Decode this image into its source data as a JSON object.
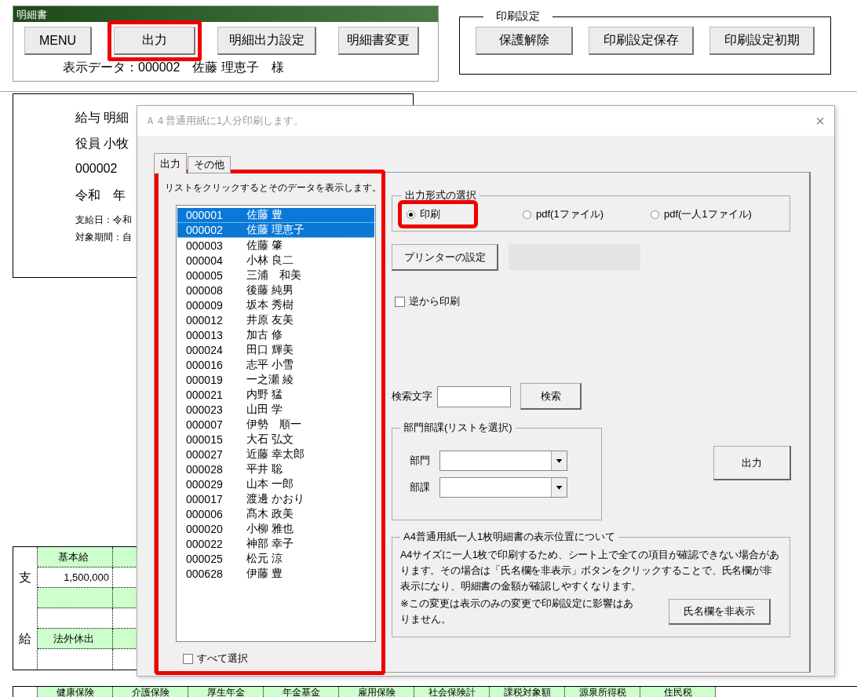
{
  "sheet_header": {
    "title": "明細書",
    "display_data": "表示データ：000002　佐藤 理恵子　様",
    "buttons": [
      {
        "label": "MENU",
        "highlighted": false
      },
      {
        "label": "出力",
        "highlighted": true
      },
      {
        "label": "明細出力設定",
        "highlighted": false
      },
      {
        "label": "明細書変更",
        "highlighted": false
      }
    ]
  },
  "print_settings": {
    "legend": "印刷設定",
    "buttons": [
      "保護解除",
      "印刷設定保存",
      "印刷設定初期"
    ]
  },
  "payslip_card": {
    "lines": [
      "給与 明細",
      "役員  小牧",
      "000002",
      "令和　年"
    ],
    "small_lines": [
      "支給日：令和",
      "対象期間：自"
    ]
  },
  "pay_table": {
    "side_labels": [
      "支",
      "給"
    ],
    "rows": [
      {
        "kind": "header",
        "text": "基本給"
      },
      {
        "kind": "value",
        "text": "1,500,000"
      },
      {
        "kind": "header"
      },
      {
        "kind": "value"
      },
      {
        "kind": "header",
        "text": "法外休出"
      },
      {
        "kind": "value"
      }
    ]
  },
  "deduction_headers": [
    "健康保険",
    "介護保険",
    "厚生年金",
    "年金基金",
    "雇用保険",
    "社会保険計",
    "課税対象額",
    "源泉所得税",
    "住民税"
  ],
  "dialog": {
    "title": "Ａ４普通用紙に1人分印刷します。",
    "close": "×",
    "tabs": [
      {
        "label": "出力",
        "selected": true
      },
      {
        "label": "その他",
        "selected": false
      }
    ],
    "list_panel": {
      "highlighted": true,
      "hint": "リストをクリックするとそのデータを表示します。",
      "select_all": {
        "label": "すべて選択",
        "checked": false
      },
      "items": [
        {
          "id": "000001",
          "name": "佐藤 豊",
          "selected": true
        },
        {
          "id": "000002",
          "name": "佐藤 理恵子",
          "selected": true
        },
        {
          "id": "000003",
          "name": "佐藤 肇",
          "selected": false
        },
        {
          "id": "000004",
          "name": "小林 良二",
          "selected": false
        },
        {
          "id": "000005",
          "name": "三浦　和美",
          "selected": false
        },
        {
          "id": "000008",
          "name": "後藤 純男",
          "selected": false
        },
        {
          "id": "000009",
          "name": "坂本 秀樹",
          "selected": false
        },
        {
          "id": "000012",
          "name": "井原 友美",
          "selected": false
        },
        {
          "id": "000013",
          "name": "加古 修",
          "selected": false
        },
        {
          "id": "000024",
          "name": "田口 輝美",
          "selected": false
        },
        {
          "id": "000016",
          "name": "志平 小雪",
          "selected": false
        },
        {
          "id": "000019",
          "name": "一之瀬 綾",
          "selected": false
        },
        {
          "id": "000021",
          "name": "内野 猛",
          "selected": false
        },
        {
          "id": "000023",
          "name": "山田 学",
          "selected": false
        },
        {
          "id": "000007",
          "name": "伊勢　順一",
          "selected": false
        },
        {
          "id": "000015",
          "name": "大石 弘文",
          "selected": false
        },
        {
          "id": "000027",
          "name": "近藤 幸太郎",
          "selected": false
        },
        {
          "id": "000028",
          "name": "平井 聡",
          "selected": false
        },
        {
          "id": "000029",
          "name": "山本 一郎",
          "selected": false
        },
        {
          "id": "000017",
          "name": "渡邊 かおり",
          "selected": false
        },
        {
          "id": "000006",
          "name": "髙木 政美",
          "selected": false
        },
        {
          "id": "000020",
          "name": "小柳 雅也",
          "selected": false
        },
        {
          "id": "000022",
          "name": "神部 幸子",
          "selected": false
        },
        {
          "id": "000025",
          "name": "松元 涼",
          "selected": false
        },
        {
          "id": "000628",
          "name": "伊藤 豊",
          "selected": false
        }
      ]
    },
    "output_format": {
      "legend": "出力形式の選択",
      "options": [
        {
          "label": "印刷",
          "selected": true,
          "highlighted": true
        },
        {
          "label": "pdf(1ファイル)",
          "selected": false,
          "highlighted": false
        },
        {
          "label": "pdf(一人1ファイル)",
          "selected": false,
          "highlighted": false
        }
      ]
    },
    "printer_button": "プリンターの設定",
    "reverse_print": {
      "label": "逆から印刷",
      "checked": false
    },
    "search": {
      "label": "検索文字",
      "button": "検索"
    },
    "department": {
      "legend": "部門部課(リストを選択)",
      "fields": [
        "部門",
        "部課"
      ]
    },
    "output_button": "出力",
    "display_position": {
      "legend": "A4普通用紙一人1枚明細書の表示位置について",
      "text": "A4サイズに一人1枚で印刷するため、シート上で全ての項目が確認できない場合があります。その場合は「氏名欄を非表示」ボタンをクリックすることで、氏名欄が非表示になり、明細書の金額が確認しやすくなります。",
      "note": "※この変更は表示のみの変更で印刷設定に影響はありません。",
      "button": "氏名欄を非表示"
    }
  }
}
